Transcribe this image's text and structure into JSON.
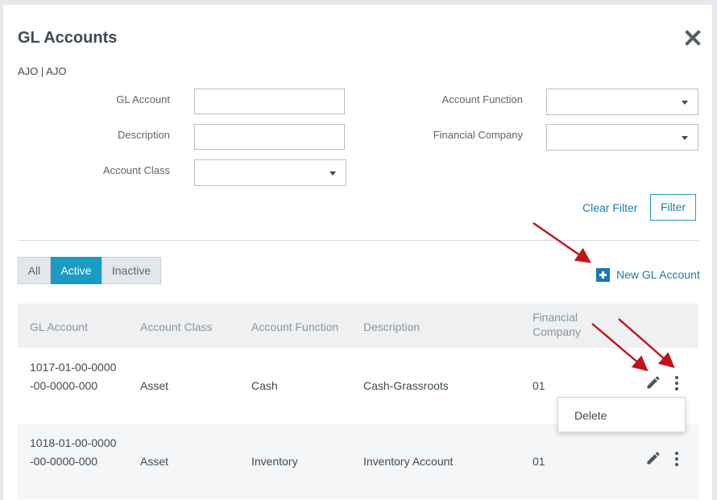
{
  "dialog": {
    "title": "GL Accounts",
    "subtitle": "AJO | AJO"
  },
  "filters": {
    "gl_account_label": "GL Account",
    "gl_account_value": "",
    "description_label": "Description",
    "description_value": "",
    "account_class_label": "Account Class",
    "account_class_value": "",
    "account_function_label": "Account Function",
    "account_function_value": "",
    "financial_company_label": "Financial Company",
    "financial_company_value": "",
    "clear_filter_label": "Clear Filter",
    "filter_label": "Filter"
  },
  "status_tabs": {
    "all": "All",
    "active": "Active",
    "inactive": "Inactive",
    "selected": "Active"
  },
  "new_gl_account_label": "New GL Account",
  "table": {
    "headers": {
      "gl_account": "GL Account",
      "account_class": "Account Class",
      "account_function": "Account Function",
      "description": "Description",
      "financial_company": "Financial Company"
    },
    "rows": [
      {
        "gl_account": "1017-01-00-0000-00-0000-000",
        "account_class": "Asset",
        "account_function": "Cash",
        "description": "Cash-Grassroots",
        "financial_company": "01"
      },
      {
        "gl_account": "1018-01-00-0000-00-0000-000",
        "account_class": "Asset",
        "account_function": "Inventory",
        "description": "Inventory Account",
        "financial_company": "01"
      }
    ]
  },
  "context_menu": {
    "items": [
      "Delete"
    ]
  },
  "colors": {
    "accent": "#1a9bc3",
    "link": "#1f7ca8",
    "annotation_arrow": "#c0141a"
  },
  "icons": {
    "close": "close-icon",
    "plus": "plus-icon",
    "edit": "pencil-icon",
    "more": "more-vertical-icon",
    "caret": "chevron-down-icon"
  }
}
